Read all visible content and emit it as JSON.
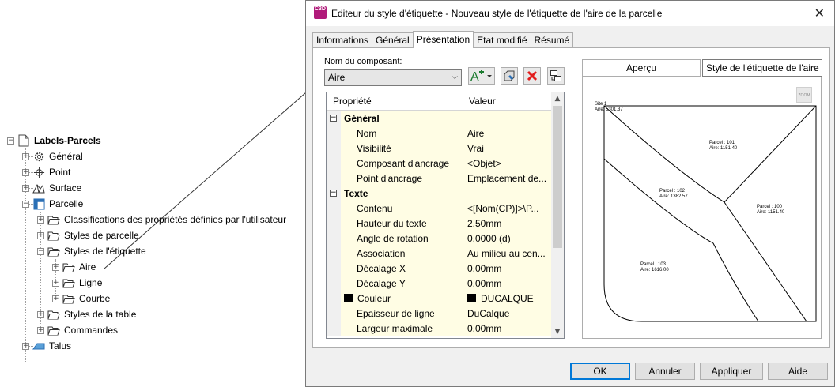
{
  "tree": {
    "root": "Labels-Parcels",
    "items": {
      "general": "Général",
      "point": "Point",
      "surface": "Surface",
      "parcelle": "Parcelle",
      "classifications": "Classifications des propriétés définies par l'utilisateur",
      "styles_parcelle": "Styles de parcelle",
      "styles_etiquette": "Styles de l'étiquette",
      "aire": "Aire",
      "ligne": "Ligne",
      "courbe": "Courbe",
      "styles_table": "Styles de la table",
      "commandes": "Commandes",
      "talus": "Talus"
    },
    "expander_plus": "+",
    "expander_minus": "−"
  },
  "dialog": {
    "title": "Editeur du style d'étiquette - Nouveau style de l'étiquette de l'aire de la parcelle",
    "app_icon_text": "C3D",
    "close": "✕",
    "tabs": [
      "Informations",
      "Général",
      "Présentation",
      "Etat modifié",
      "Résumé"
    ],
    "active_tab": "Présentation",
    "component_label": "Nom du composant:",
    "component_value": "Aire",
    "grid": {
      "col_property": "Propriété",
      "col_value": "Valeur",
      "rows": [
        {
          "type": "cat",
          "name": "Général",
          "value": ""
        },
        {
          "type": "prop",
          "name": "Nom",
          "value": "Aire"
        },
        {
          "type": "prop",
          "name": "Visibilité",
          "value": "Vrai"
        },
        {
          "type": "prop",
          "name": "Composant d'ancrage",
          "value": "<Objet>"
        },
        {
          "type": "prop",
          "name": "Point d'ancrage",
          "value": "Emplacement de..."
        },
        {
          "type": "cat",
          "name": "Texte",
          "value": ""
        },
        {
          "type": "prop",
          "name": "Contenu",
          "value": "<[Nom(CP)]>\\P..."
        },
        {
          "type": "prop",
          "name": "Hauteur du texte",
          "value": "2.50mm"
        },
        {
          "type": "prop",
          "name": "Angle de rotation",
          "value": "0.0000 (d)"
        },
        {
          "type": "prop",
          "name": "Association",
          "value": "Au milieu au cen..."
        },
        {
          "type": "prop",
          "name": "Décalage X",
          "value": "0.00mm"
        },
        {
          "type": "prop",
          "name": "Décalage Y",
          "value": "0.00mm"
        },
        {
          "type": "color",
          "name": "Couleur",
          "value": "DUCALQUE"
        },
        {
          "type": "prop",
          "name": "Epaisseur de ligne",
          "value": "DuCalque"
        },
        {
          "type": "prop",
          "name": "Largeur maximale",
          "value": "0.00mm"
        }
      ]
    },
    "preview": {
      "tab_label": "Aperçu",
      "style_select": "Style de l'étiquette de l'aire",
      "zoom_text": "ZOOM",
      "labels": {
        "site": "Site 1",
        "site_area": "Aire: 5301.37",
        "p101": "Parcel : 101",
        "p101_area": "Aire: 1151.40",
        "p102": "Parcel : 102",
        "p102_area": "Aire: 1382.57",
        "p100": "Parcel : 100",
        "p100_area": "Aire: 1151.40",
        "p103": "Parcel : 103",
        "p103_area": "Aire: 1616.00"
      }
    },
    "buttons": {
      "ok": "OK",
      "cancel": "Annuler",
      "apply": "Appliquer",
      "help": "Aide"
    },
    "colors": {
      "accent": "#0078d7",
      "grid_row_bg": "#fffde4",
      "delete_red": "#e21c1c",
      "app_icon": "#b01a7a"
    }
  }
}
